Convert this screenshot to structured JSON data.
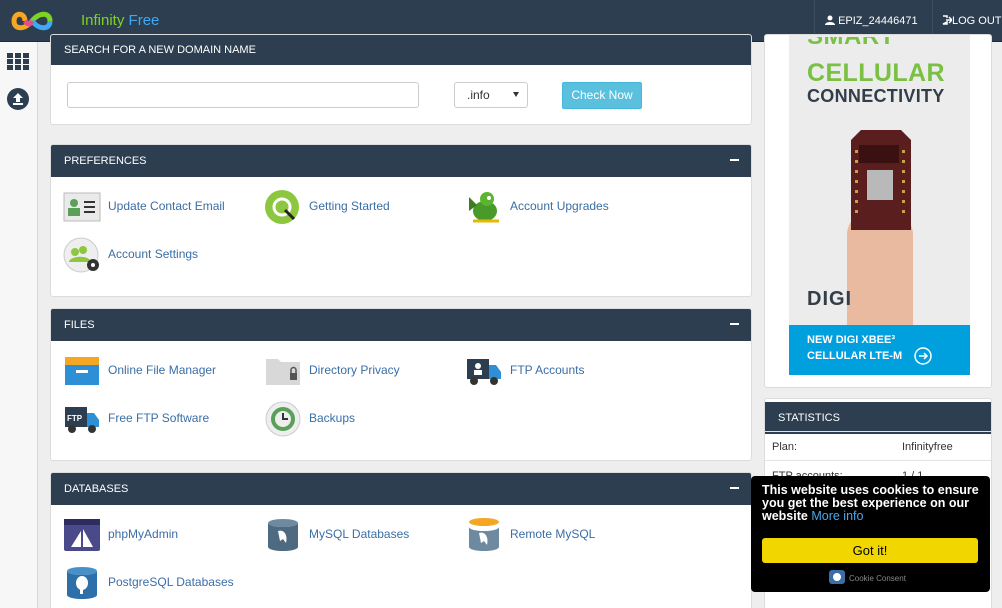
{
  "brand": {
    "part1": "Infinity",
    "part2": "Free"
  },
  "header": {
    "username": "EPIZ_24446471",
    "logout_label": "LOG OUT"
  },
  "search": {
    "title": "SEARCH FOR A NEW DOMAIN NAME",
    "input_value": "",
    "tld_selected": ".info",
    "check_button": "Check Now"
  },
  "preferences": {
    "title": "PREFERENCES",
    "items": [
      {
        "label": "Update Contact Email",
        "icon": "contact-card-icon"
      },
      {
        "label": "Getting Started",
        "icon": "getting-started-icon"
      },
      {
        "label": "Account Upgrades",
        "icon": "dragon-mascot-icon"
      },
      {
        "label": "Account Settings",
        "icon": "users-gear-icon"
      }
    ]
  },
  "files": {
    "title": "FILES",
    "items": [
      {
        "label": "Online File Manager",
        "icon": "file-box-icon"
      },
      {
        "label": "Directory Privacy",
        "icon": "locked-folder-icon"
      },
      {
        "label": "FTP Accounts",
        "icon": "ftp-truck-user-icon"
      },
      {
        "label": "Free FTP Software",
        "icon": "ftp-truck-icon"
      },
      {
        "label": "Backups",
        "icon": "backup-clock-icon"
      }
    ]
  },
  "databases": {
    "title": "DATABASES",
    "items": [
      {
        "label": "phpMyAdmin",
        "icon": "phpmyadmin-icon"
      },
      {
        "label": "MySQL Databases",
        "icon": "mysql-dolphin-icon"
      },
      {
        "label": "Remote MySQL",
        "icon": "remote-mysql-icon"
      },
      {
        "label": "PostgreSQL Databases",
        "icon": "postgresql-elephant-icon"
      }
    ]
  },
  "ad": {
    "line1": "SMART",
    "line2": "CELLULAR",
    "line3": "CONNECTIVITY",
    "brand": "DIGI",
    "cta1": "NEW DIGI XBEE³",
    "cta2": "CELLULAR LTE-M"
  },
  "statistics": {
    "title": "STATISTICS",
    "rows": [
      {
        "key": "Plan:",
        "value": "Infinityfree"
      },
      {
        "key": "FTP accounts:",
        "value": "1 / 1"
      }
    ]
  },
  "cookie": {
    "message": "This website uses cookies to ensure you get the best experience on our website",
    "more_info": "More info",
    "button": "Got it!",
    "footer": "Cookie Consent"
  },
  "colors": {
    "header_bg": "#2c3e50",
    "link": "#3a6ea5",
    "check_button": "#5bc0de",
    "cookie_button": "#f1d600"
  }
}
